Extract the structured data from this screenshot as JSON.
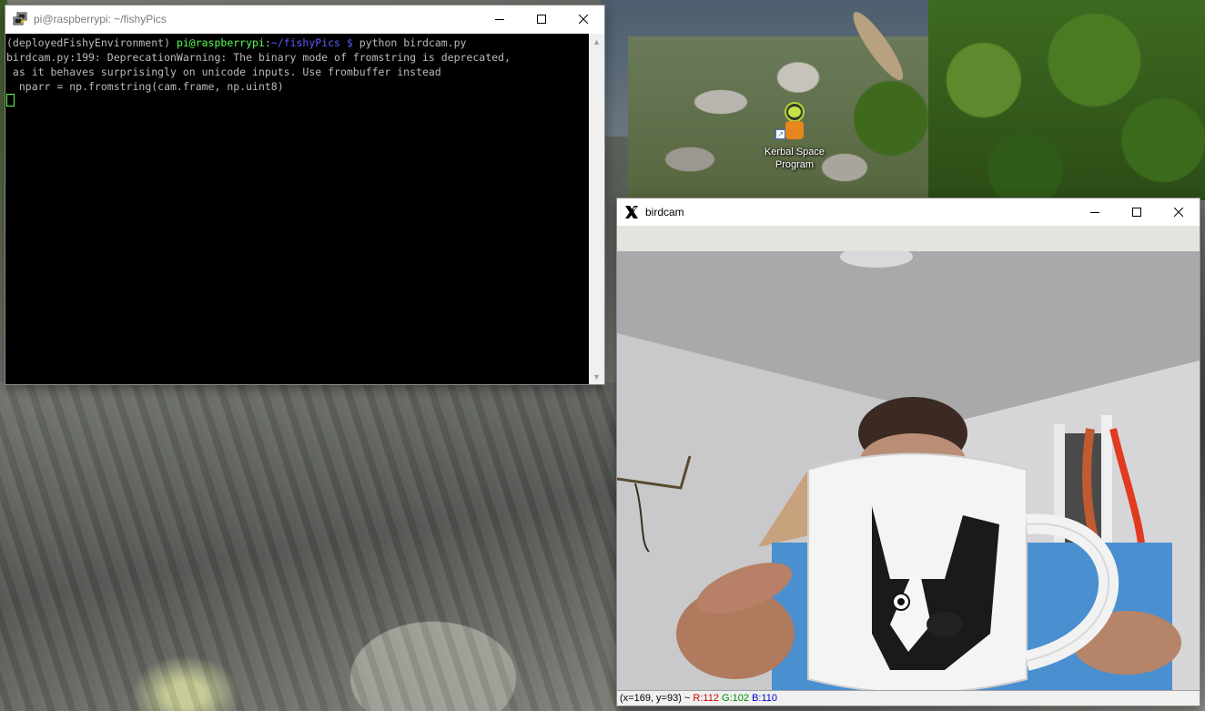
{
  "desktop": {
    "icons": [
      {
        "label_line1": "Kerbal Space",
        "label_line2": "Program",
        "icon": "kerbal-astronaut-icon"
      }
    ]
  },
  "terminal": {
    "title": "pi@raspberrypi: ~/fishyPics",
    "icon": "putty-icon",
    "lines": [
      {
        "env": "(deployedFishyEnvironment) ",
        "userhost": "pi@raspberrypi",
        "colon": ":",
        "path": "~/fishyPics $",
        "cmd": " python birdcam.py"
      },
      {
        "text": "birdcam.py:199: DeprecationWarning: The binary mode of fromstring is deprecated,"
      },
      {
        "text": " as it behaves surprisingly on unicode inputs. Use frombuffer instead"
      },
      {
        "text": "  nparr = np.fromstring(cam.frame, np.uint8)"
      }
    ],
    "colors": {
      "background": "#000000",
      "text": "#bbbbbb",
      "prompt_green": "#55ff55",
      "prompt_blue": "#5c5cff"
    }
  },
  "birdcam": {
    "title": "birdcam",
    "icon": "x11-icon",
    "status": {
      "coords": "(x=169, y=93) ~ ",
      "r": "R:112",
      "g": "G:102",
      "b": "B:110"
    }
  },
  "window_controls": {
    "minimize": "minimize-icon",
    "maximize": "maximize-icon",
    "close": "close-icon"
  }
}
